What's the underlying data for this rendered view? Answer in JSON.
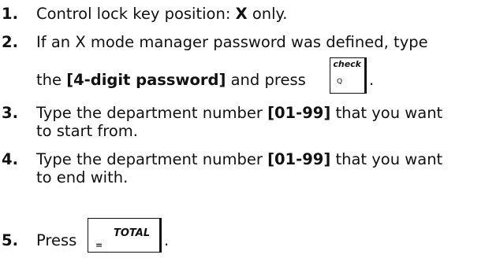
{
  "steps": [
    {
      "number": "1.",
      "text_before": "Control lock key position: ",
      "bold": "X",
      "text_after": " only."
    },
    {
      "number": "2.",
      "line1": "If an X mode manager password was defined, type",
      "line2_before": "the ",
      "line2_bold": "[4-digit password]",
      "line2_after": " and press",
      "key_top": "check",
      "key_bottom": "Q",
      "end": "."
    },
    {
      "number": "3.",
      "line1_before": "Type the department number ",
      "line1_bold": "[01-99]",
      "line1_after": " that you want",
      "line2": "to start from."
    },
    {
      "number": "4.",
      "line1_before": "Type the department number ",
      "line1_bold": "[01-99]",
      "line1_after": " that you want",
      "line2": "to end with."
    },
    {
      "number": "5.",
      "text": "Press",
      "key_label": "TOTAL",
      "key_bottom": "=",
      "end": "."
    }
  ]
}
